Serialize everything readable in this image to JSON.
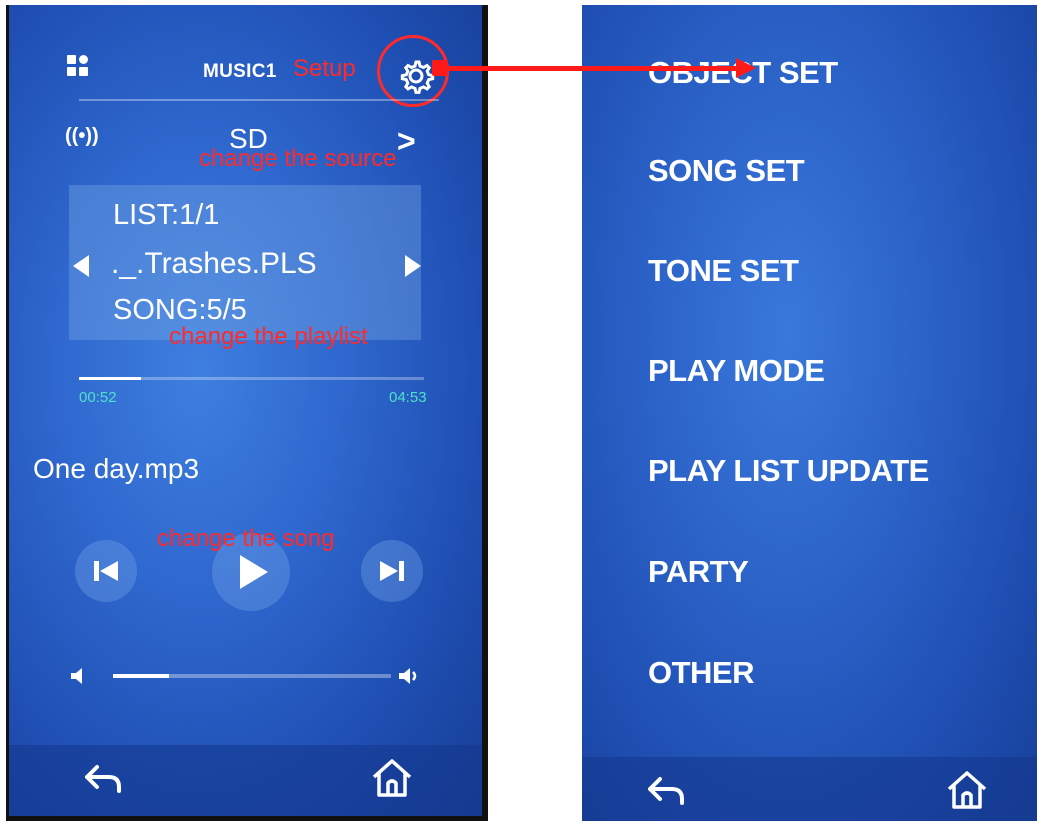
{
  "music_screen": {
    "header": {
      "title": "MUSIC1",
      "setup_annotation": "Setup"
    },
    "source": {
      "label": "SD",
      "next_label": ">",
      "annotation": "change the source"
    },
    "playlist": {
      "list_line": "LIST:1/1",
      "file_line": "._.Trashes.PLS",
      "song_line": "SONG:5/5",
      "annotation": "change the playlist"
    },
    "progress": {
      "elapsed": "00:52",
      "total": "04:53",
      "fraction": 0.18
    },
    "song": {
      "title": "One day.mp3",
      "annotation": "change the song"
    },
    "volume": {
      "fraction": 0.2
    },
    "icons": [
      "grid-icon",
      "gear-icon",
      "radio-signal-icon",
      "prev-track-icon",
      "play-icon",
      "next-track-icon",
      "volume-low-icon",
      "volume-high-icon",
      "back-icon",
      "home-icon"
    ]
  },
  "setup_menu": {
    "items": [
      {
        "label": "OBJECT SET"
      },
      {
        "label": "SONG SET"
      },
      {
        "label": "TONE SET"
      },
      {
        "label": "PLAY MODE"
      },
      {
        "label": "PLAY LIST UPDATE"
      },
      {
        "label": "PARTY"
      },
      {
        "label": "OTHER"
      }
    ]
  },
  "colors": {
    "annotation": "#ff2a2a",
    "screen_blue": "#2f68cf",
    "time_text": "#4fe0c8"
  }
}
